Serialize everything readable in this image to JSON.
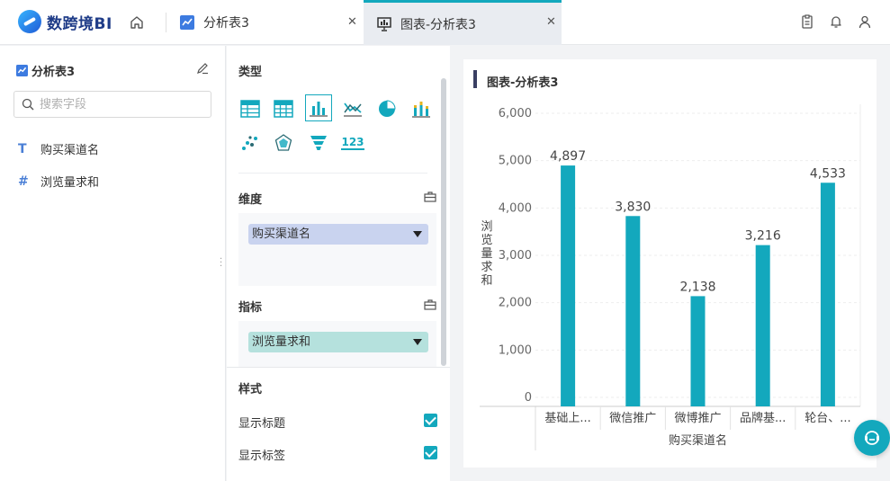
{
  "app": {
    "name": "数跨境BI"
  },
  "tabs": [
    {
      "label": "分析表3",
      "close": "✕"
    },
    {
      "label": "图表-分析表3",
      "close": "✕"
    }
  ],
  "fields": {
    "title": "分析表3",
    "search_placeholder": "搜索字段",
    "items": [
      {
        "type": "T",
        "label": "购买渠道名"
      },
      {
        "type": "#",
        "label": "浏览量求和"
      }
    ]
  },
  "config": {
    "type_label": "类型",
    "dimension_label": "维度",
    "dimension_value": "购买渠道名",
    "metric_label": "指标",
    "metric_value": "浏览量求和",
    "style_label": "样式",
    "style_options": [
      {
        "label": "显示标题",
        "checked": true
      },
      {
        "label": "显示标签",
        "checked": true
      }
    ],
    "chart_types": [
      "table",
      "pivot",
      "bar",
      "line",
      "pie",
      "stacked",
      "scatter",
      "radar",
      "funnel",
      "number"
    ],
    "number_type_label": "123"
  },
  "chart": {
    "title": "图表-分析表3",
    "bar_color": "#13a8bd"
  },
  "chart_data": {
    "type": "bar",
    "categories": [
      "基础上...",
      "微信推广",
      "微博推广",
      "品牌基...",
      "轮台、..."
    ],
    "values": [
      4897,
      3830,
      2138,
      3216,
      4533
    ],
    "value_labels": [
      "4,897",
      "3,830",
      "2,138",
      "3,216",
      "4,533"
    ],
    "xlabel": "购买渠道名",
    "ylabel": "浏览量求和",
    "ylim": [
      0,
      6000
    ],
    "yticks": [
      0,
      1000,
      2000,
      3000,
      4000,
      5000,
      6000
    ],
    "ytick_labels": [
      "0",
      "1,000",
      "2,000",
      "3,000",
      "4,000",
      "5,000",
      "6,000"
    ],
    "grid": true
  }
}
